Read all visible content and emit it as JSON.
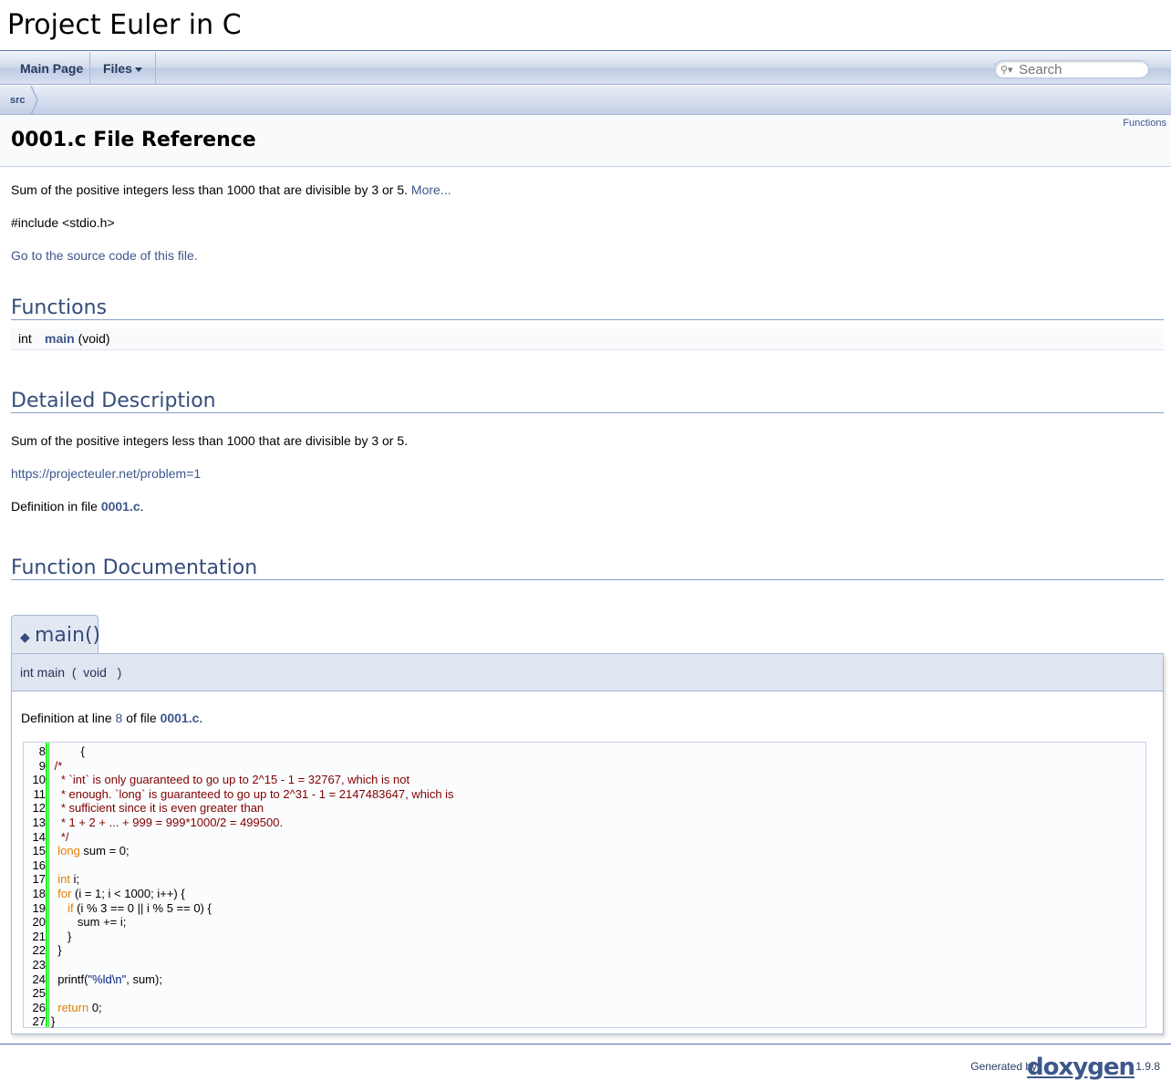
{
  "project": {
    "name": "Project Euler in C"
  },
  "nav": {
    "main_page": "Main Page",
    "files": "Files",
    "search_placeholder": "Search"
  },
  "breadcrumb": {
    "item": "src"
  },
  "header": {
    "summary_link": "Functions",
    "title": "0001.c File Reference"
  },
  "brief": {
    "text": "Sum of the positive integers less than 1000 that are divisible by 3 or 5.",
    "more": "More..."
  },
  "include": "#include <stdio.h>",
  "source_link": "Go to the source code of this file.",
  "functions_section": {
    "heading": "Functions",
    "rows": [
      {
        "type": "int",
        "name": "main",
        "args": "(void)"
      }
    ]
  },
  "detailed": {
    "heading": "Detailed Description",
    "text": "Sum of the positive integers less than 1000 that are divisible by 3 or 5.",
    "url": "https://projecteuler.net/problem=1",
    "def_prefix": "Definition in file ",
    "def_file": "0001.c",
    "def_suffix": "."
  },
  "function_doc": {
    "heading": "Function Documentation",
    "tab_title": "main()",
    "proto_ret_name": "int main",
    "proto_open": "(",
    "proto_arg": "void",
    "proto_close": ")",
    "def_prefix": "Definition at line ",
    "def_line": "8",
    "def_mid": " of file ",
    "def_file": "0001.c",
    "def_suffix": "."
  },
  "code": {
    "lines": [
      {
        "n": "8",
        "parts": [
          [
            "plain",
            "         {"
          ]
        ]
      },
      {
        "n": "9",
        "parts": [
          [
            "cmt",
            " /*"
          ]
        ]
      },
      {
        "n": "10",
        "parts": [
          [
            "cmt",
            "   * `int` is only guaranteed to go up to 2^15 - 1 = 32767, which is not"
          ]
        ]
      },
      {
        "n": "11",
        "parts": [
          [
            "cmt",
            "   * enough. `long` is guaranteed to go up to 2^31 - 1 = 2147483647, which is"
          ]
        ]
      },
      {
        "n": "12",
        "parts": [
          [
            "cmt",
            "   * sufficient since it is even greater than"
          ]
        ]
      },
      {
        "n": "13",
        "parts": [
          [
            "cmt",
            "   * 1 + 2 + ... + 999 = 999*1000/2 = 499500."
          ]
        ]
      },
      {
        "n": "14",
        "parts": [
          [
            "cmt",
            "   */"
          ]
        ]
      },
      {
        "n": "15",
        "parts": [
          [
            "plain",
            "  "
          ],
          [
            "kw",
            "long"
          ],
          [
            "plain",
            " sum = 0;"
          ]
        ]
      },
      {
        "n": "16",
        "parts": [
          [
            "plain",
            ""
          ]
        ]
      },
      {
        "n": "17",
        "parts": [
          [
            "plain",
            "  "
          ],
          [
            "kw",
            "int"
          ],
          [
            "plain",
            " i;"
          ]
        ]
      },
      {
        "n": "18",
        "parts": [
          [
            "plain",
            "  "
          ],
          [
            "kw",
            "for"
          ],
          [
            "plain",
            " (i = 1; i < 1000; i++) {"
          ]
        ]
      },
      {
        "n": "19",
        "parts": [
          [
            "plain",
            "     "
          ],
          [
            "kw",
            "if"
          ],
          [
            "plain",
            " (i % 3 == 0 || i % 5 == 0) {"
          ]
        ]
      },
      {
        "n": "20",
        "parts": [
          [
            "plain",
            "        sum += i;"
          ]
        ]
      },
      {
        "n": "21",
        "parts": [
          [
            "plain",
            "     }"
          ]
        ]
      },
      {
        "n": "22",
        "parts": [
          [
            "plain",
            "  }"
          ]
        ]
      },
      {
        "n": "23",
        "parts": [
          [
            "plain",
            ""
          ]
        ]
      },
      {
        "n": "24",
        "parts": [
          [
            "plain",
            "  printf("
          ],
          [
            "str",
            "\"%ld\\n\""
          ],
          [
            "plain",
            ", sum);"
          ]
        ]
      },
      {
        "n": "25",
        "parts": [
          [
            "plain",
            ""
          ]
        ]
      },
      {
        "n": "26",
        "parts": [
          [
            "plain",
            "  "
          ],
          [
            "kw",
            "return"
          ],
          [
            "plain",
            " 0;"
          ]
        ]
      },
      {
        "n": "27",
        "parts": [
          [
            "plain",
            "}"
          ]
        ]
      }
    ]
  },
  "footer": {
    "generated_by": "Generated by",
    "logo": "doxygen",
    "version": "1.9.8"
  }
}
